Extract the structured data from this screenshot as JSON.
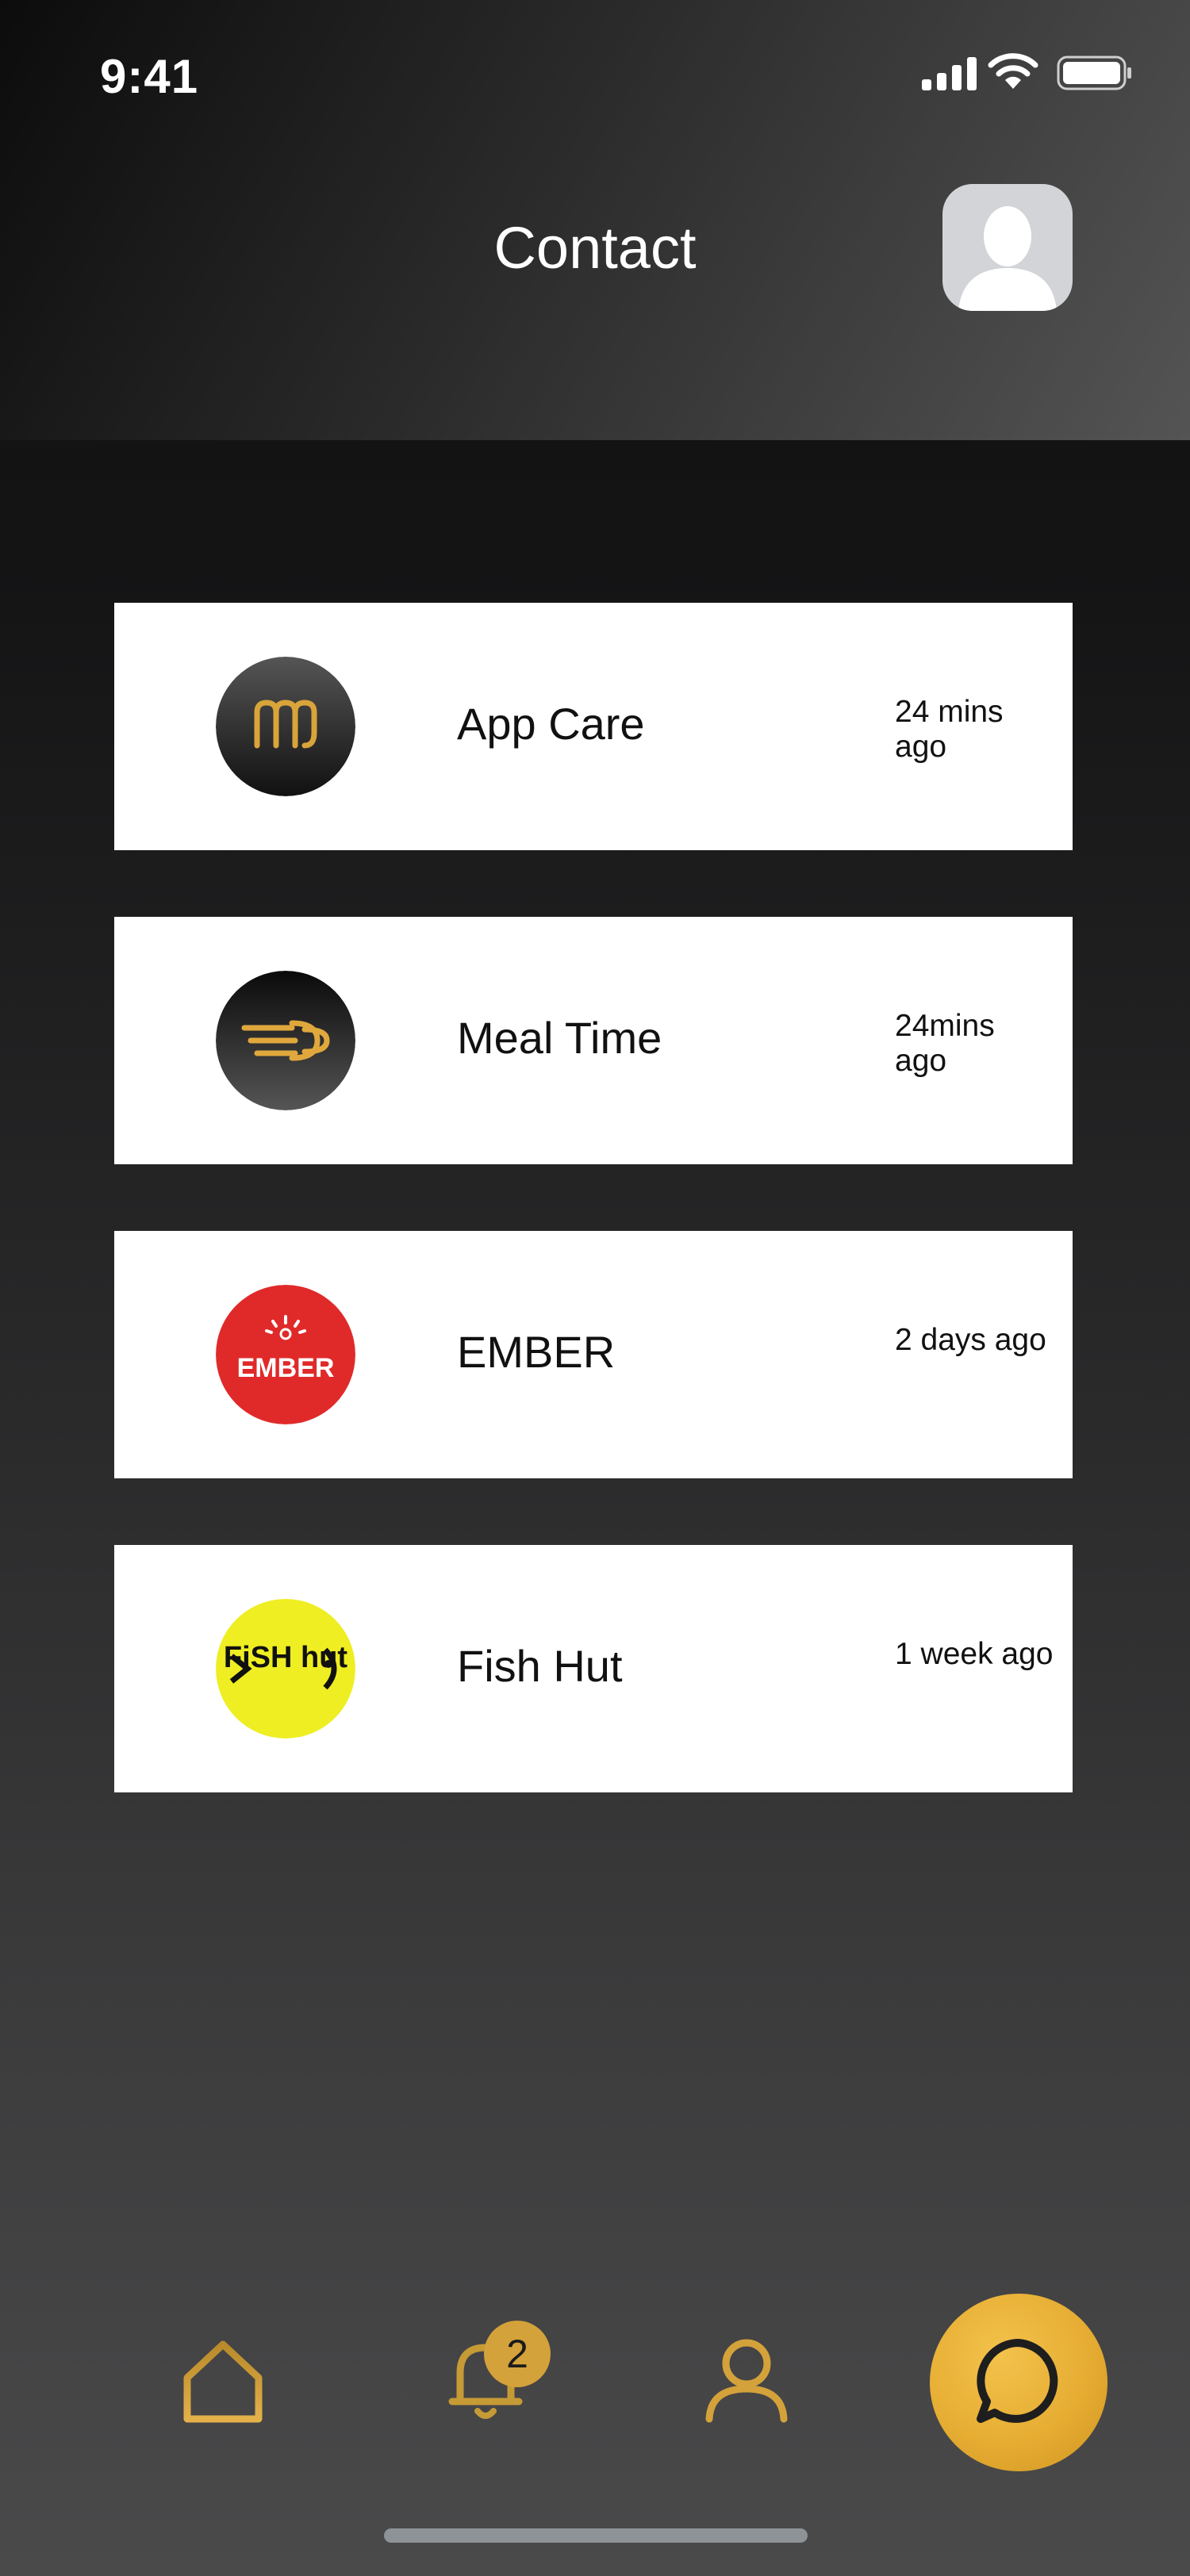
{
  "status_bar": {
    "time": "9:41"
  },
  "header": {
    "title": "Contact"
  },
  "contacts": [
    {
      "name": "App Care",
      "time": "24 mins ago",
      "logo": "app-care-logo"
    },
    {
      "name": "Meal Time",
      "time": "24mins ago",
      "logo": "meal-time-logo"
    },
    {
      "name": "EMBER",
      "time": "2 days ago",
      "logo": "ember-logo",
      "logo_text": "EMBER"
    },
    {
      "name": "Fish Hut",
      "time": "1 week ago",
      "logo": "fish-hut-logo",
      "logo_text": "FiSH hut"
    }
  ],
  "nav": {
    "notification_count": "2",
    "items": [
      "home-icon",
      "bell-icon",
      "user-icon",
      "chat-icon"
    ]
  },
  "colors": {
    "accent_gold": "#e6ad33",
    "ember_red": "#e02a2a",
    "fish_hut_yellow": "#eeee22",
    "card_bg": "#ffffff"
  }
}
